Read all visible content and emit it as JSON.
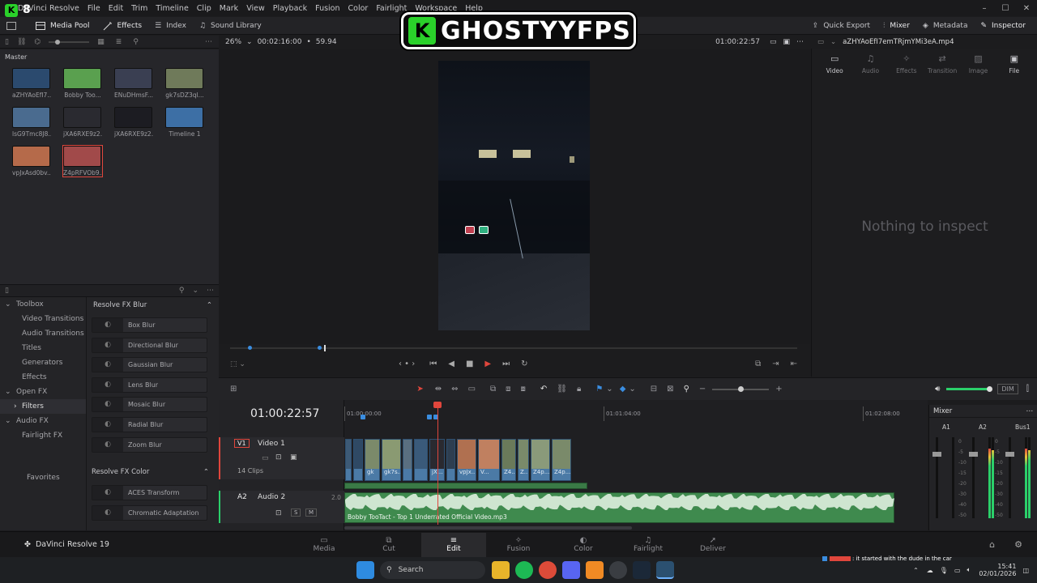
{
  "overlay": {
    "logo_letter": "K",
    "channel": "GHOSTYYFPS",
    "badge_letter": "K",
    "badge_count": "8"
  },
  "menu": [
    "DaVinci Resolve",
    "File",
    "Edit",
    "Trim",
    "Timeline",
    "Clip",
    "Mark",
    "View",
    "Playback",
    "Fusion",
    "Color",
    "Fairlight",
    "Workspace",
    "Help"
  ],
  "toolbar": {
    "media_pool": "Media Pool",
    "effects": "Effects",
    "index": "Index",
    "sound_library": "Sound Library",
    "quick_export": "Quick Export",
    "mixer": "Mixer",
    "metadata": "Metadata",
    "inspector": "Inspector"
  },
  "viewer": {
    "zoom": "26%",
    "duration": "00:02:16:00",
    "fps": "59.94",
    "timecode": "01:00:22:57",
    "clip_name": "aZHYAoEfI7emTRjmYMi3eA.mp4"
  },
  "media_pool": {
    "bin": "Master",
    "clips": [
      {
        "name": "aZHYAoEfI7...",
        "color": "#2b4a6e"
      },
      {
        "name": "Bobby Too...",
        "color": "#5aa04f"
      },
      {
        "name": "ENuDHmsF...",
        "color": "#3a3f52"
      },
      {
        "name": "gk7sDZ3ql...",
        "color": "#6f7a5a"
      },
      {
        "name": "lsG9Tmc8J8...",
        "color": "#4a6b8f"
      },
      {
        "name": "jXA6RXE9z2...",
        "color": "#2a2a30"
      },
      {
        "name": "jXA6RXE9z2...",
        "color": "#1c1c22"
      },
      {
        "name": "Timeline 1",
        "color": "#3d6fa5"
      },
      {
        "name": "vpJxAsd0bv...",
        "color": "#b56a4a"
      },
      {
        "name": "Z4pRFVOb9...",
        "color": "#a14a4a"
      }
    ]
  },
  "effects_tree": [
    {
      "label": "Toolbox",
      "expand": "⌄"
    },
    {
      "label": "Video Transitions",
      "expand": ""
    },
    {
      "label": "Audio Transitions",
      "expand": ""
    },
    {
      "label": "Titles",
      "expand": ""
    },
    {
      "label": "Generators",
      "expand": ""
    },
    {
      "label": "Effects",
      "expand": ""
    },
    {
      "label": "Open FX",
      "expand": "⌄"
    },
    {
      "label": "Filters",
      "expand": "›"
    },
    {
      "label": "Audio FX",
      "expand": "⌄"
    },
    {
      "label": "Fairlight FX",
      "expand": ""
    },
    {
      "label": "Favorites",
      "expand": ""
    }
  ],
  "effects_list": {
    "blur_header": "Resolve FX Blur",
    "blur": [
      "Box Blur",
      "Directional Blur",
      "Gaussian Blur",
      "Lens Blur",
      "Mosaic Blur",
      "Radial Blur",
      "Zoom Blur"
    ],
    "color_header": "Resolve FX Color",
    "color": [
      "ACES Transform",
      "Chromatic Adaptation"
    ]
  },
  "inspector": {
    "tabs": [
      "Video",
      "Audio",
      "Effects",
      "Transition",
      "Image",
      "File"
    ],
    "empty": "Nothing to inspect"
  },
  "timeline": {
    "timecode": "01:00:22:57",
    "ruler": [
      "01:00:00:00",
      "01:01:04:00",
      "01:02:08:00"
    ],
    "video_track": {
      "id": "V1",
      "name": "Video 1",
      "clips_count": "14 Clips"
    },
    "audio_track": {
      "id": "A2",
      "name": "Audio 2",
      "channels": "2.0",
      "clip": "Bobby TooTact - Top 1 Underrated Official Video.mp3"
    },
    "clips": [
      {
        "label": "",
        "color": "#3d5a76"
      },
      {
        "label": "",
        "color": "#2f4964"
      },
      {
        "label": "gk",
        "color": "#7b8a6a"
      },
      {
        "label": "gk7s...",
        "color": "#8a9a72"
      },
      {
        "label": "",
        "color": "#5a6f80"
      },
      {
        "label": "",
        "color": "#3a5a7a"
      },
      {
        "label": "jX...",
        "color": "#2a2a30"
      },
      {
        "label": "",
        "color": "#2e3e50"
      },
      {
        "label": "vpJx...",
        "color": "#b07050"
      },
      {
        "label": "V...",
        "color": "#c08060"
      },
      {
        "label": "Z4...",
        "color": "#6a7a5a"
      },
      {
        "label": "Z...",
        "color": "#7a8a6a"
      },
      {
        "label": "Z4p...",
        "color": "#8a9a7a"
      },
      {
        "label": "Z4p...",
        "color": "#7a8a6a"
      }
    ],
    "audio_readout": "DIM"
  },
  "mixer": {
    "title": "Mixer",
    "channels": [
      "A1",
      "A2",
      "Bus1"
    ],
    "scale": [
      "0",
      "-5",
      "-10",
      "-15",
      "-20",
      "-30",
      "-40",
      "-50"
    ]
  },
  "pages": {
    "product": "DaVinci Resolve 19",
    "tabs": [
      "Media",
      "Cut",
      "Edit",
      "Fusion",
      "Color",
      "Fairlight",
      "Deliver"
    ],
    "active": "Edit"
  },
  "taskbar": {
    "search": "Search",
    "chat": ": it started with the dude in the car",
    "time": "15:41",
    "date": "02/01/2026"
  }
}
